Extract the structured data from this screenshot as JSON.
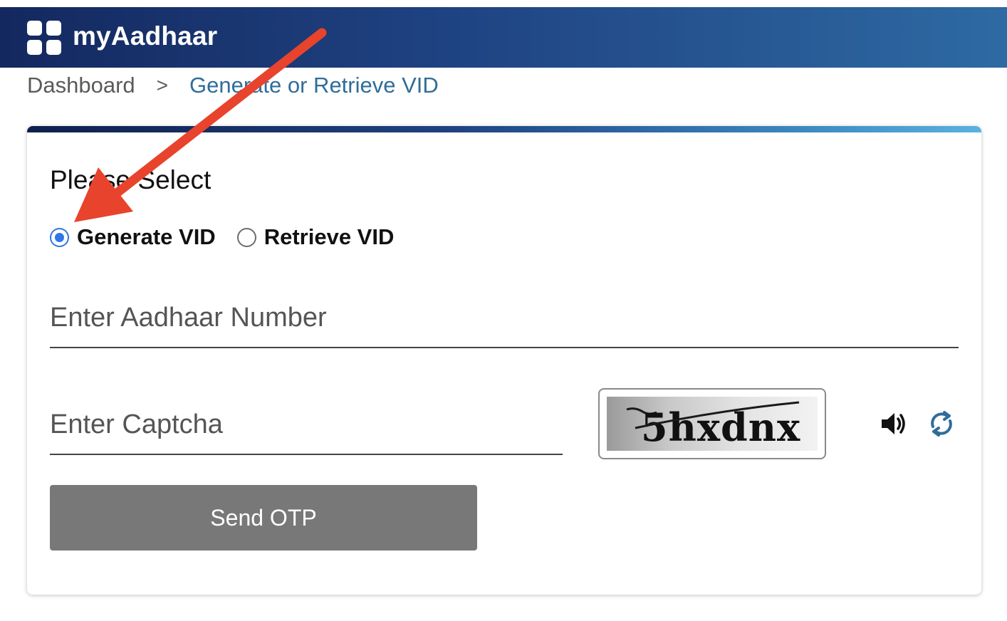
{
  "header": {
    "app_title": "myAadhaar",
    "logo_icon": "app-grid-icon"
  },
  "breadcrumb": {
    "home": "Dashboard",
    "separator": ">",
    "current": "Generate or Retrieve VID"
  },
  "form": {
    "section_title": "Please Select",
    "options": [
      {
        "label": "Generate VID",
        "selected": true
      },
      {
        "label": "Retrieve VID",
        "selected": false
      }
    ],
    "aadhaar_placeholder": "Enter Aadhaar Number",
    "captcha_placeholder": "Enter Captcha",
    "captcha_text": "5hxdnx",
    "audio_icon": "speaker-icon",
    "refresh_icon": "refresh-icon",
    "send_button": "Send OTP"
  },
  "colors": {
    "header_start": "#14285f",
    "header_end": "#2e6aa3",
    "link": "#2f6d9a",
    "radio_selected": "#2f76e8",
    "button_bg": "#787878",
    "annotation_arrow": "#e8432c"
  }
}
